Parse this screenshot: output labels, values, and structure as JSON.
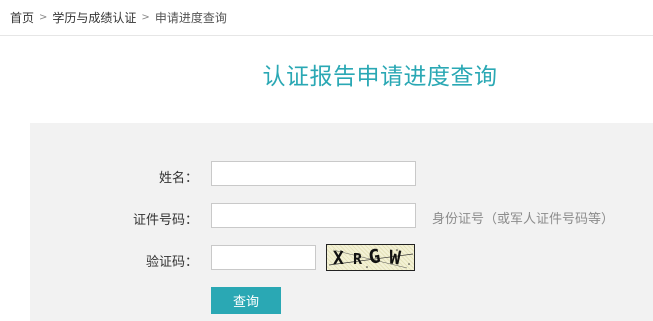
{
  "breadcrumb": {
    "home": "首页",
    "section": "学历与成绩认证",
    "current": "申请进度查询",
    "separator": ">"
  },
  "page_title": "认证报告申请进度查询",
  "form": {
    "name_label": "姓名：",
    "name_value": "",
    "id_label": "证件号码：",
    "id_value": "",
    "id_hint": "身份证号（或军人证件号码等）",
    "captcha_label": "验证码：",
    "captcha_value": "",
    "captcha_image_text": [
      "X",
      "R",
      "G",
      "W"
    ],
    "submit_label": "查询"
  },
  "colors": {
    "accent": "#2aa8b4",
    "panel_bg": "#f2f2f2",
    "hint_text": "#8c8c8c"
  }
}
